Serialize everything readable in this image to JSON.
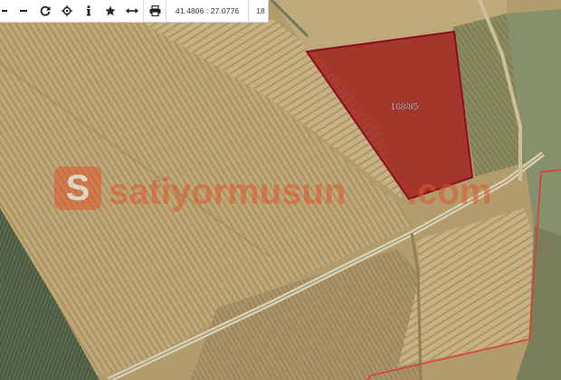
{
  "toolbar": {
    "buttons": [
      {
        "name": "zoom-in-icon"
      },
      {
        "name": "zoom-out-icon"
      },
      {
        "name": "refresh-icon"
      },
      {
        "name": "locate-icon"
      },
      {
        "name": "info-icon"
      },
      {
        "name": "star-icon"
      },
      {
        "name": "measure-icon"
      },
      {
        "name": "print-icon"
      }
    ],
    "coordinates": "41.4806 : 27.0776",
    "zoom_level": "18"
  },
  "map": {
    "parcel_label": "108/85",
    "parcel_fill": "#a01a1a",
    "parcel_stroke": "#8a0f1e",
    "boundary_color": "#e03a32",
    "watermark": {
      "part1": "satiyormusun",
      "part2": ".com",
      "color": "#e0552e"
    }
  }
}
